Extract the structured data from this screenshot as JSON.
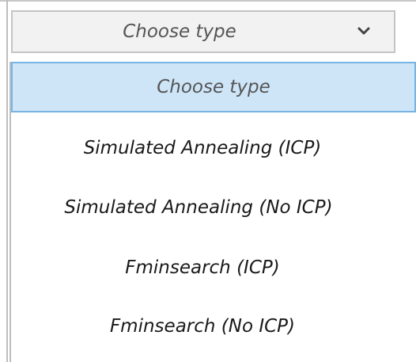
{
  "select": {
    "value": "Choose type",
    "icon": "chevron-down-icon"
  },
  "dropdown": {
    "options": [
      {
        "label": "Choose type",
        "selected": true
      },
      {
        "label": "Simulated Annealing (ICP)",
        "selected": false
      },
      {
        "label": "Simulated Annealing (No ICP)",
        "selected": false
      },
      {
        "label": "Fminsearch (ICP)",
        "selected": false
      },
      {
        "label": "Fminsearch (No ICP)",
        "selected": false
      }
    ]
  },
  "colors": {
    "highlight": "#cde5f7",
    "highlight_border": "#78b4e3",
    "select_background": "#f2f2f2"
  }
}
